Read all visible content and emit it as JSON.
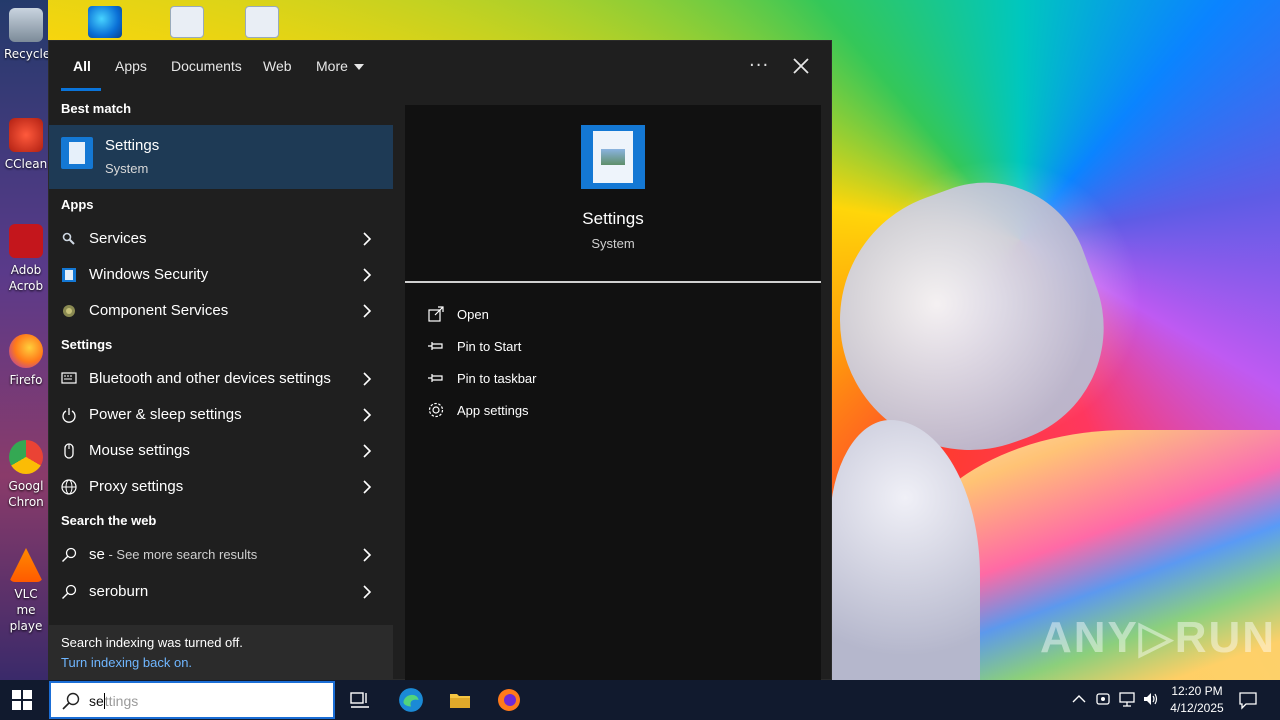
{
  "desktop": {
    "icons": [
      {
        "label": "Recycle"
      },
      {
        "label": "CClean"
      },
      {
        "label": "Adob Acrob"
      },
      {
        "label": "Firefo"
      },
      {
        "label": "Googl Chron"
      },
      {
        "label": "VLC me playe"
      }
    ],
    "watermark": "ANY▷RUN"
  },
  "search_panel": {
    "tabs": [
      {
        "label": "All",
        "active": true
      },
      {
        "label": "Apps"
      },
      {
        "label": "Documents"
      },
      {
        "label": "Web"
      },
      {
        "label": "More"
      }
    ],
    "options_icon": "more-dots-icon",
    "close_icon": "close-icon",
    "best_match": {
      "heading": "Best match",
      "title": "Settings",
      "subtitle": "System"
    },
    "apps": {
      "heading": "Apps",
      "items": [
        {
          "label": "Services",
          "icon": "services-icon"
        },
        {
          "label": "Windows Security",
          "icon": "windows-security-icon"
        },
        {
          "label": "Component Services",
          "icon": "component-services-icon"
        }
      ]
    },
    "settings": {
      "heading": "Settings",
      "items": [
        {
          "label": "Bluetooth and other devices settings",
          "icon": "devices-icon"
        },
        {
          "label": "Power & sleep settings",
          "icon": "power-icon"
        },
        {
          "label": "Mouse settings",
          "icon": "mouse-icon"
        },
        {
          "label": "Proxy settings",
          "icon": "globe-icon"
        }
      ]
    },
    "web": {
      "heading": "Search the web",
      "items": [
        {
          "label": "se",
          "suffix": " - See more search results",
          "icon": "search-icon"
        },
        {
          "label": "seroburn",
          "icon": "search-icon"
        }
      ]
    },
    "info": {
      "line1": "Search indexing was turned off.",
      "line2": "Turn indexing back on."
    },
    "detail": {
      "title": "Settings",
      "subtitle": "System",
      "actions": [
        {
          "label": "Open",
          "icon": "open-icon"
        },
        {
          "label": "Pin to Start",
          "icon": "pin-icon"
        },
        {
          "label": "Pin to taskbar",
          "icon": "pin-icon"
        },
        {
          "label": "App settings",
          "icon": "gear-icon"
        }
      ]
    }
  },
  "taskbar": {
    "search": {
      "typed": "se",
      "suggestion": "ttings"
    },
    "clock": {
      "time": "12:20 PM",
      "date": "4/12/2025"
    }
  },
  "colors": {
    "panel_bg": "#1f1f1f",
    "highlight": "#1e3a55",
    "accent": "#0a74da",
    "link": "#6fb6ff",
    "taskbar": "#111a2e"
  }
}
